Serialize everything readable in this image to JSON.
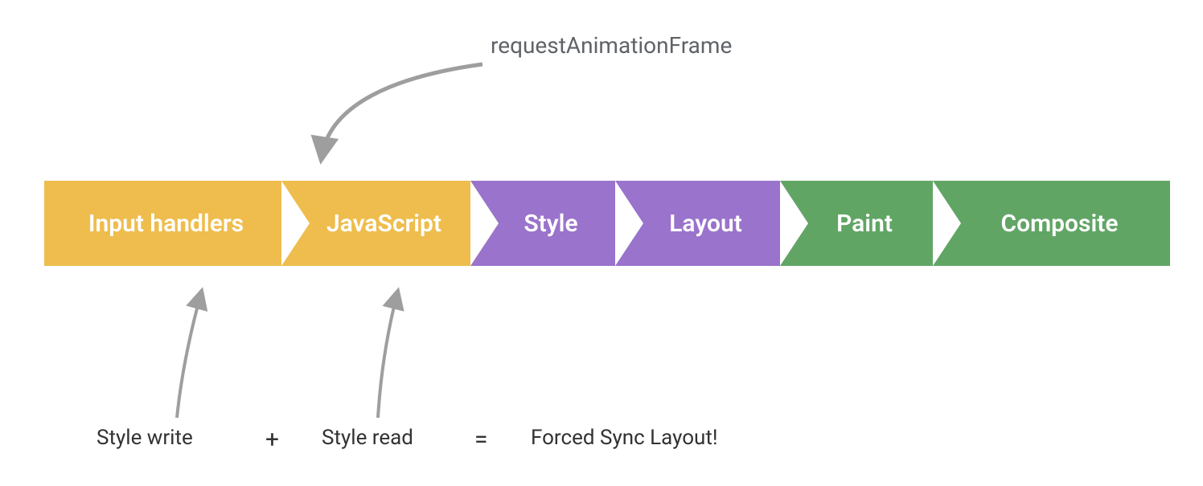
{
  "annotations": {
    "top": "requestAnimationFrame",
    "bottom": {
      "style_write": "Style write",
      "plus": "+",
      "style_read": "Style read",
      "equals": "=",
      "result": "Forced Sync Layout!"
    }
  },
  "colors": {
    "yellow": "#eebd4d",
    "purple": "#9a73cc",
    "green": "#61a565",
    "arrow": "#9e9e9e",
    "text": "#555555"
  },
  "pipeline": [
    {
      "label": "Input handlers",
      "color": "yellow"
    },
    {
      "label": "JavaScript",
      "color": "yellow"
    },
    {
      "label": "Style",
      "color": "purple"
    },
    {
      "label": "Layout",
      "color": "purple"
    },
    {
      "label": "Paint",
      "color": "green"
    },
    {
      "label": "Composite",
      "color": "green"
    }
  ]
}
